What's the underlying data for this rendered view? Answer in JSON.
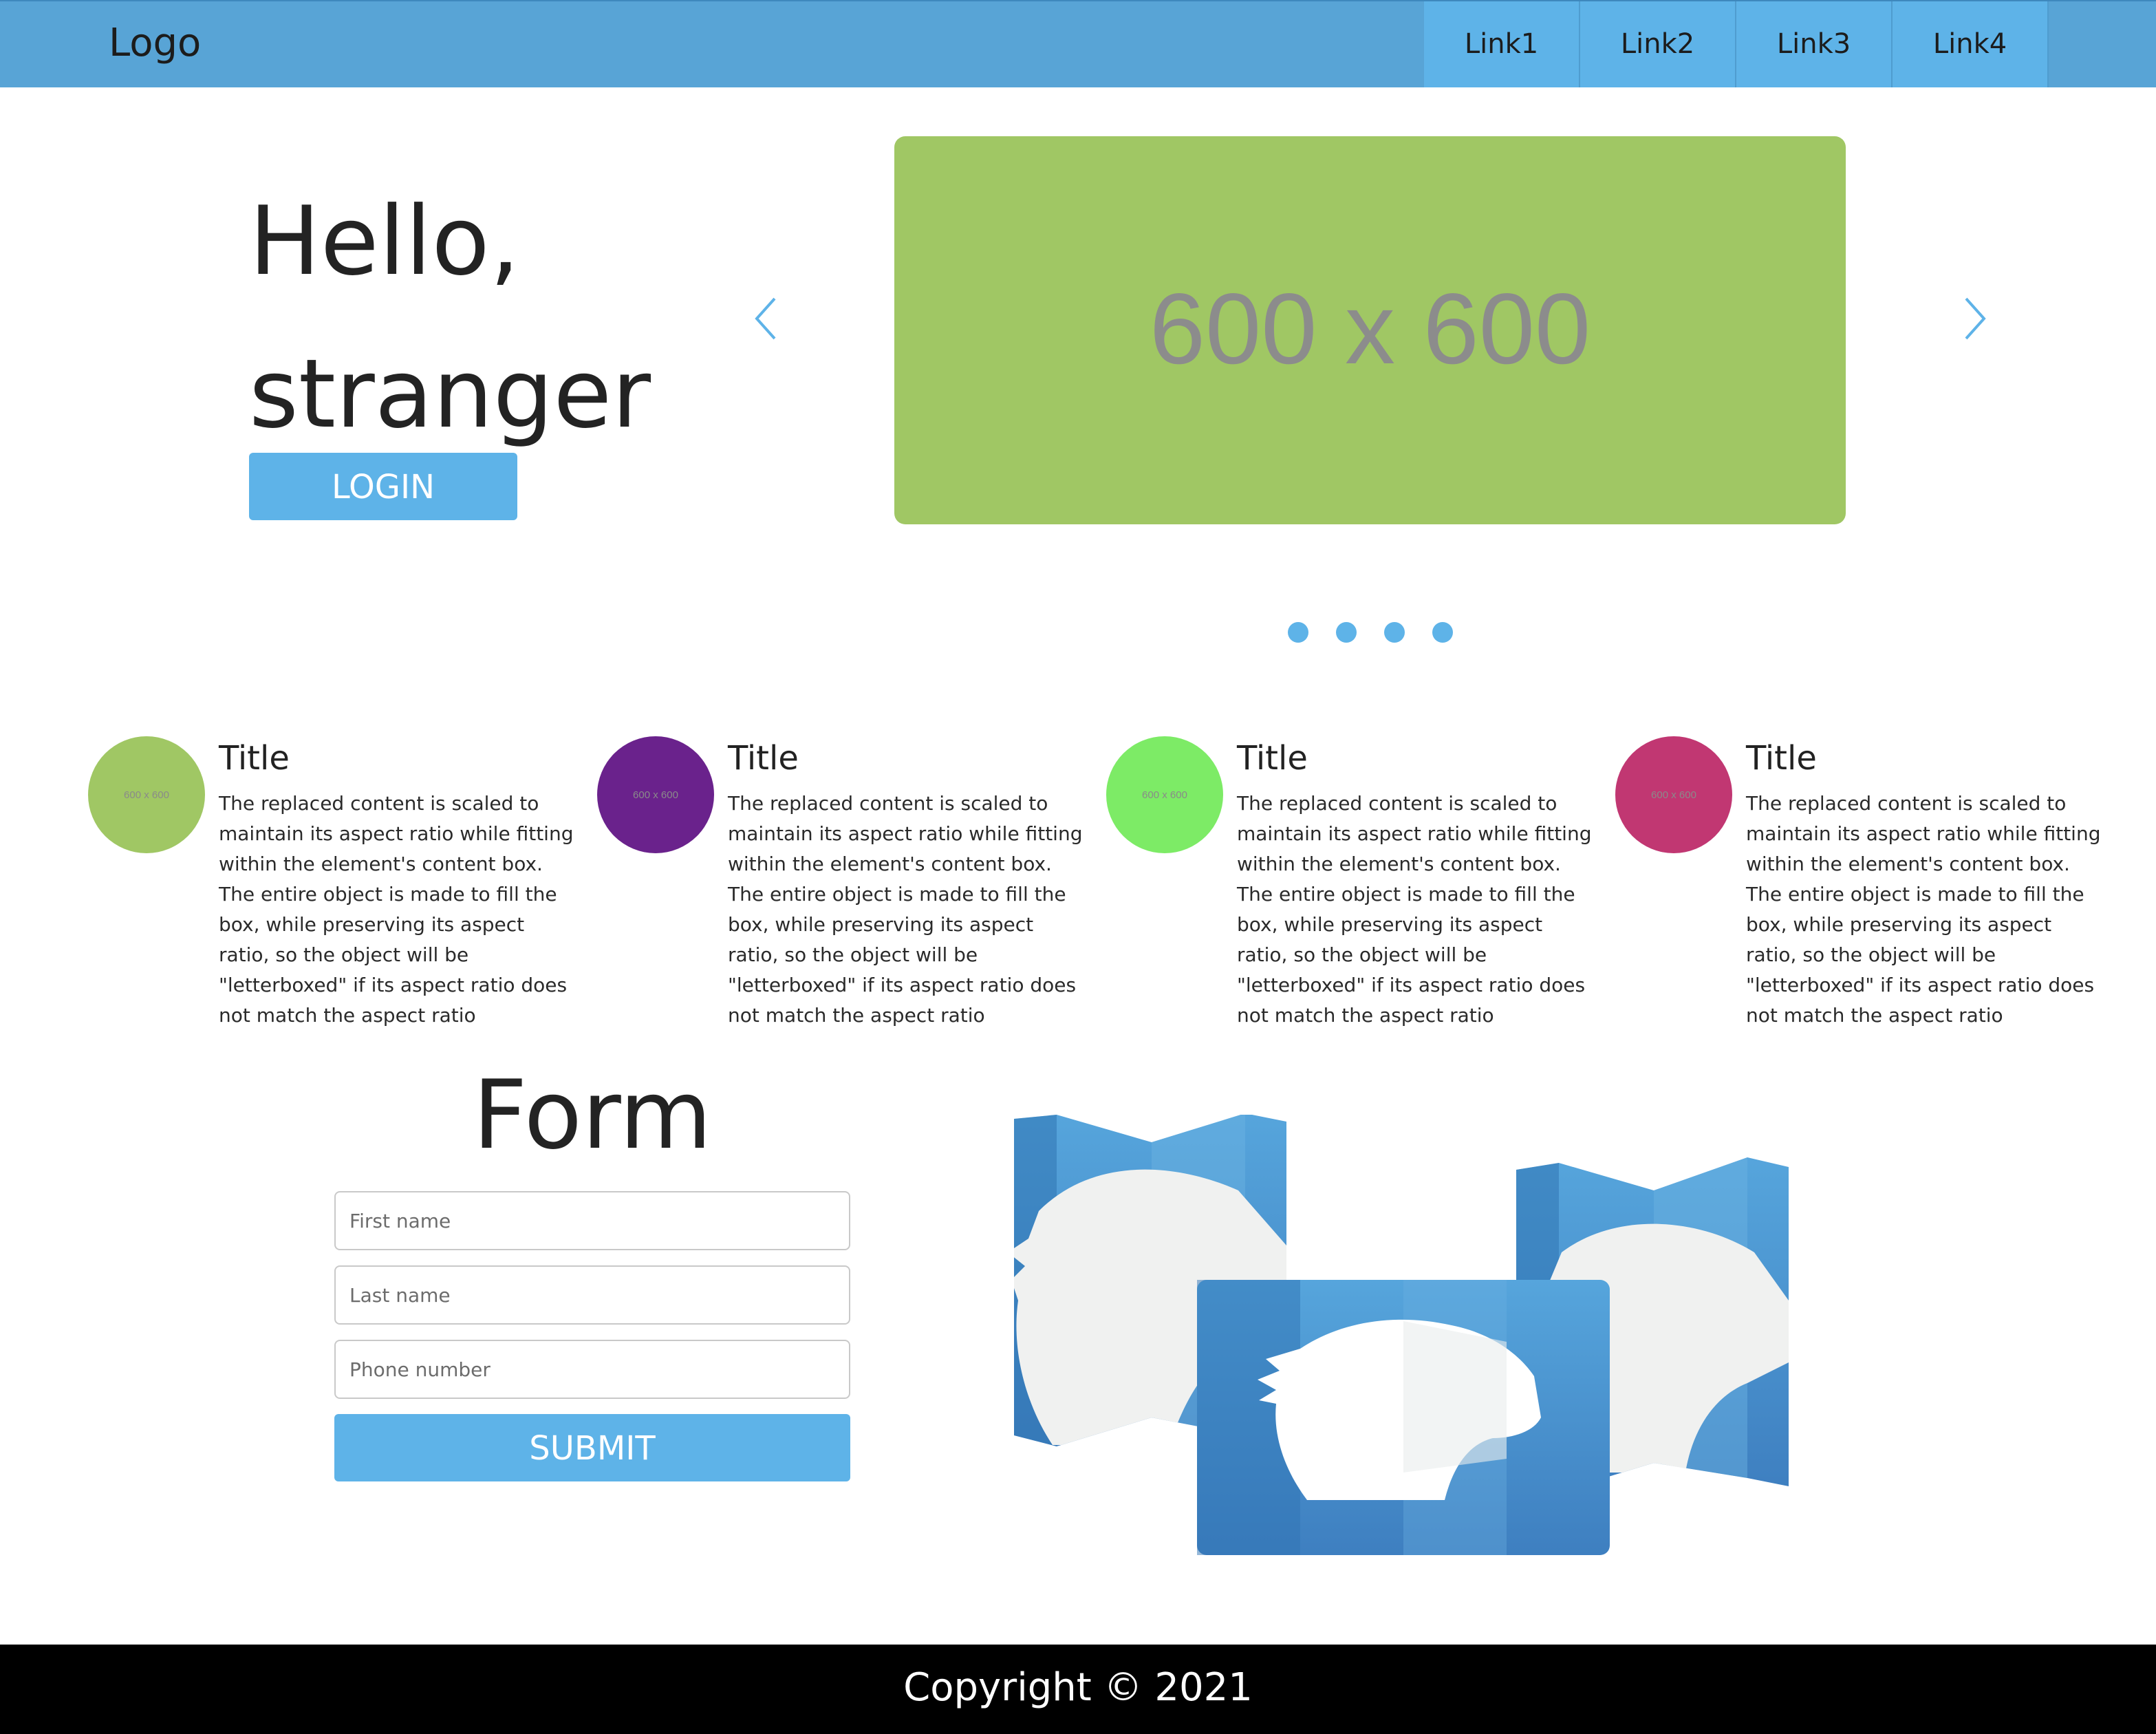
{
  "header": {
    "logo": "Logo",
    "nav": [
      "Link1",
      "Link2",
      "Link3",
      "Link4"
    ]
  },
  "hero": {
    "title_line1": "Hello,",
    "title_line2": "stranger",
    "login_label": "LOGIN",
    "slide_text": "600 x 600",
    "slide_color": "#a0c764",
    "dot_count": 4
  },
  "features": [
    {
      "circle_color": "#a0c764",
      "circle_text": "600 x 600",
      "title": "Title",
      "text": "The replaced content is scaled to maintain its aspect ratio while fitting within the element's content box. The entire object is made to fill the box, while preserving its aspect ratio, so the object will be \"letterboxed\" if its aspect ratio does not match the aspect ratio"
    },
    {
      "circle_color": "#6a228c",
      "circle_text": "600 x 600",
      "title": "Title",
      "text": "The replaced content is scaled to maintain its aspect ratio while fitting within the element's content box. The entire object is made to fill the box, while preserving its aspect ratio, so the object will be \"letterboxed\" if its aspect ratio does not match the aspect ratio"
    },
    {
      "circle_color": "#7deb66",
      "circle_text": "600 x 600",
      "title": "Title",
      "text": "The replaced content is scaled to maintain its aspect ratio while fitting within the element's content box. The entire object is made to fill the box, while preserving its aspect ratio, so the object will be \"letterboxed\" if its aspect ratio does not match the aspect ratio"
    },
    {
      "circle_color": "#c13772",
      "circle_text": "600 x 600",
      "title": "Title",
      "text": "The replaced content is scaled to maintain its aspect ratio while fitting within the element's content box. The entire object is made to fill the box, while preserving its aspect ratio, so the object will be \"letterboxed\" if its aspect ratio does not match the aspect ratio"
    }
  ],
  "form": {
    "title": "Form",
    "first_name_placeholder": "First name",
    "last_name_placeholder": "Last name",
    "phone_placeholder": "Phone number",
    "submit_label": "SUBMIT"
  },
  "footer": {
    "copyright": "Copyright © 2021"
  },
  "colors": {
    "header": "#58a4d6",
    "nav_link": "#5eb3e8",
    "accent": "#5eb3e8",
    "footer": "#000000"
  }
}
